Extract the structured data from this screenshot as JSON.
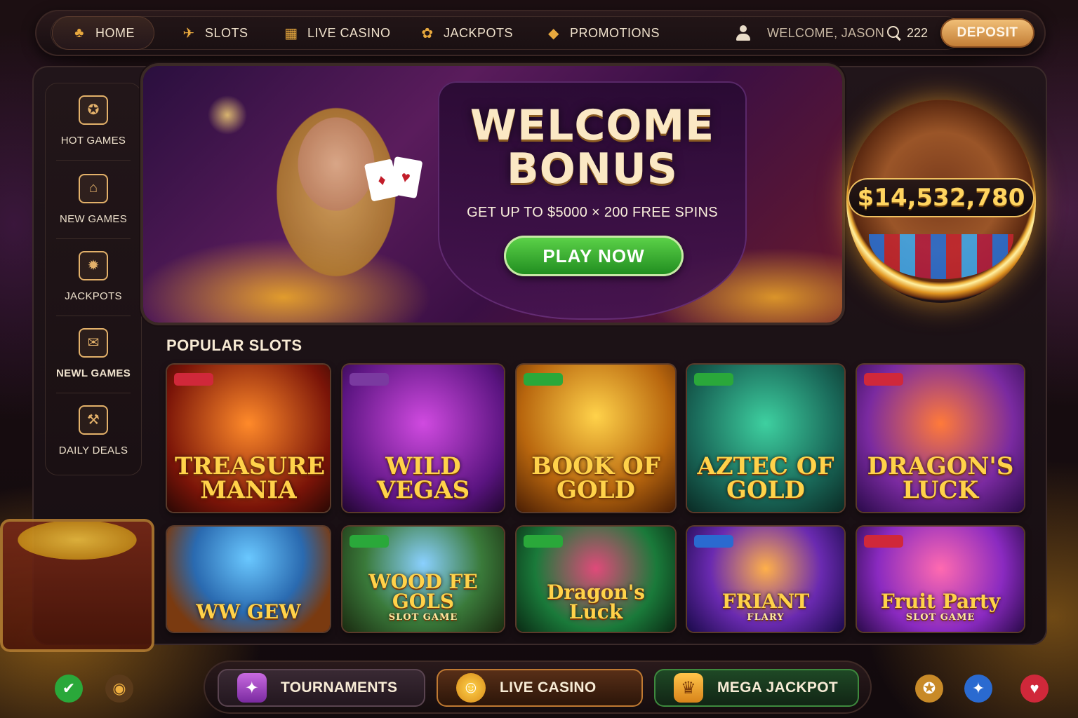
{
  "nav": {
    "items": [
      {
        "label": "HOME",
        "icon": "home-icon"
      },
      {
        "label": "SLOTS",
        "icon": "slots-icon"
      },
      {
        "label": "LIVE CASINO",
        "icon": "live-casino-icon"
      },
      {
        "label": "JACKPOTS",
        "icon": "jackpots-icon"
      },
      {
        "label": "PROMOTIONS",
        "icon": "promotions-icon"
      }
    ],
    "welcome_text": "WELCOME, JASON",
    "search_count": "222",
    "deposit_label": "DEPOSIT",
    "active": "HOME"
  },
  "sidebar": {
    "items": [
      {
        "label": "HOT GAMES",
        "icon": "hot-games-icon"
      },
      {
        "label": "NEW GAMES",
        "icon": "new-games-icon"
      },
      {
        "label": "JACKPOTS",
        "icon": "jackpots-icon"
      },
      {
        "label": "NEWL GAMES",
        "icon": "mail-icon"
      },
      {
        "label": "DAILY DEALS",
        "icon": "daily-deals-icon"
      }
    ]
  },
  "hero": {
    "title_line1": "WELCOME",
    "title_line2": "BONUS",
    "subtitle": "GET UP TO $5000 × 200 FREE SPINS",
    "cta": "PLAY NOW"
  },
  "jackpot": {
    "amount": "$14,532,780"
  },
  "popular": {
    "title": "POPULAR SLOTS",
    "games": [
      {
        "title": "TREASURE MANIA",
        "subtitle": "",
        "theme": "fire"
      },
      {
        "title": "WILD VEGAS",
        "subtitle": "",
        "theme": "purple"
      },
      {
        "title": "BOOK OF GOLD",
        "subtitle": "",
        "theme": "gold"
      },
      {
        "title": "AZTEC OF GOLD",
        "subtitle": "",
        "theme": "jungle"
      },
      {
        "title": "DRAGON'S LUCK",
        "subtitle": "",
        "theme": "dragon"
      },
      {
        "title": "WW GEW",
        "subtitle": "",
        "theme": "sky"
      },
      {
        "title": "WOOD FE GOLS",
        "subtitle": "SLOT GAME",
        "theme": "forest"
      },
      {
        "title": "Dragon's Luck",
        "subtitle": "",
        "theme": "emerald"
      },
      {
        "title": "FRIANT",
        "subtitle": "FLARY",
        "theme": "violet"
      },
      {
        "title": "Fruit Party",
        "subtitle": "SLOT GAME",
        "theme": "candy"
      }
    ]
  },
  "bottom": {
    "tournaments": "TOURNAMENTS",
    "live_casino": "LIVE CASINO",
    "mega_jackpot": "MEGA JACKPOT"
  },
  "colors": {
    "accent_gold": "#e8a93e",
    "deposit": "#d99a52",
    "play_green": "#3fb534",
    "jackpot_text": "#ffd560"
  }
}
